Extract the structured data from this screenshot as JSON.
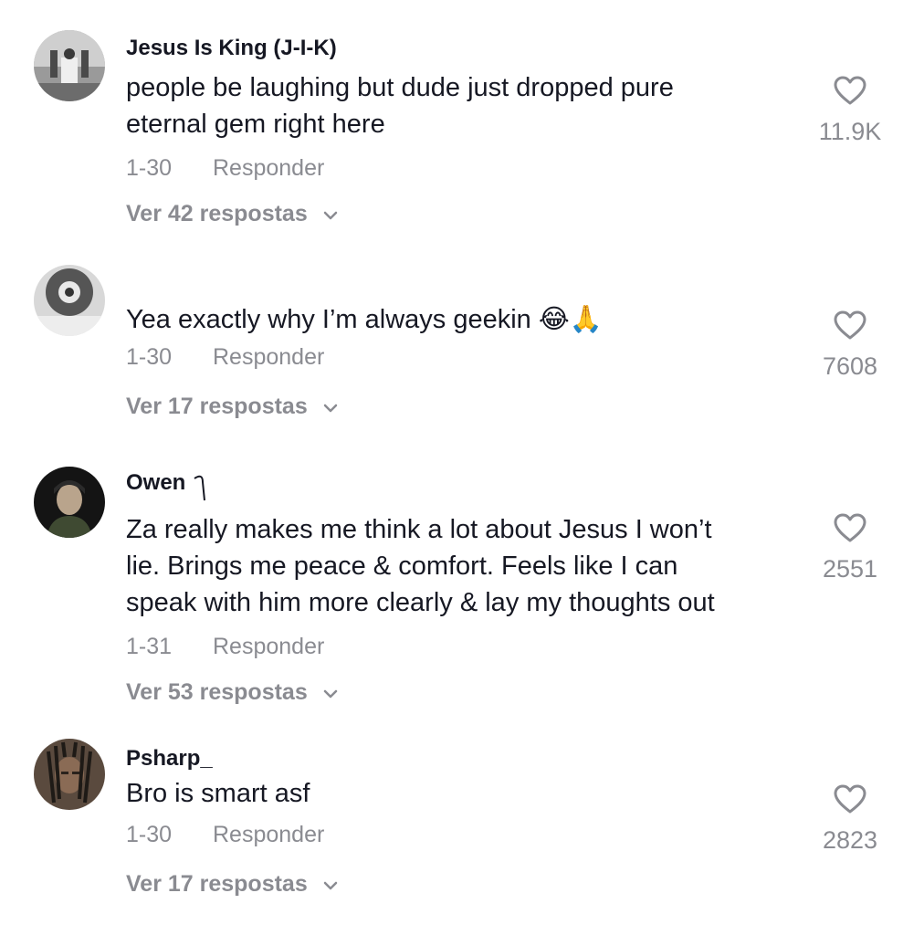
{
  "comments": [
    {
      "username": "Jesus Is King (J-I-K)",
      "text_lines": [
        "people be laughing but dude just dropped pure",
        "eternal gem right here"
      ],
      "date": "1-30",
      "reply_label": "Responder",
      "view_replies": "Ver 42 respostas",
      "likes": "11.9K",
      "avatar_icon": "avatar-photo-icon"
    },
    {
      "username": "",
      "text_lines": [
        "Yea exactly why I’m always geekin 😂🙏"
      ],
      "date": "1-30",
      "reply_label": "Responder",
      "view_replies": "Ver 17 respostas",
      "likes": "7608",
      "avatar_icon": "avatar-photo-icon"
    },
    {
      "username": "Owen",
      "text_lines": [
        "Za really makes me think a lot about Jesus I won’t",
        "lie. Brings me peace & comfort. Feels like I can",
        "speak with him more clearly & lay my thoughts out"
      ],
      "date": "1-31",
      "reply_label": "Responder",
      "view_replies": "Ver 53 respostas",
      "likes": "2551",
      "avatar_icon": "avatar-photo-icon"
    },
    {
      "username": "Psharp_",
      "text_lines": [
        "Bro is smart asf"
      ],
      "date": "1-30",
      "reply_label": "Responder",
      "view_replies": "Ver 17 respostas",
      "likes": "2823",
      "avatar_icon": "avatar-photo-icon"
    }
  ],
  "colors": {
    "primary_text": "#161823",
    "secondary_text": "#8a8b91",
    "background": "#ffffff"
  }
}
